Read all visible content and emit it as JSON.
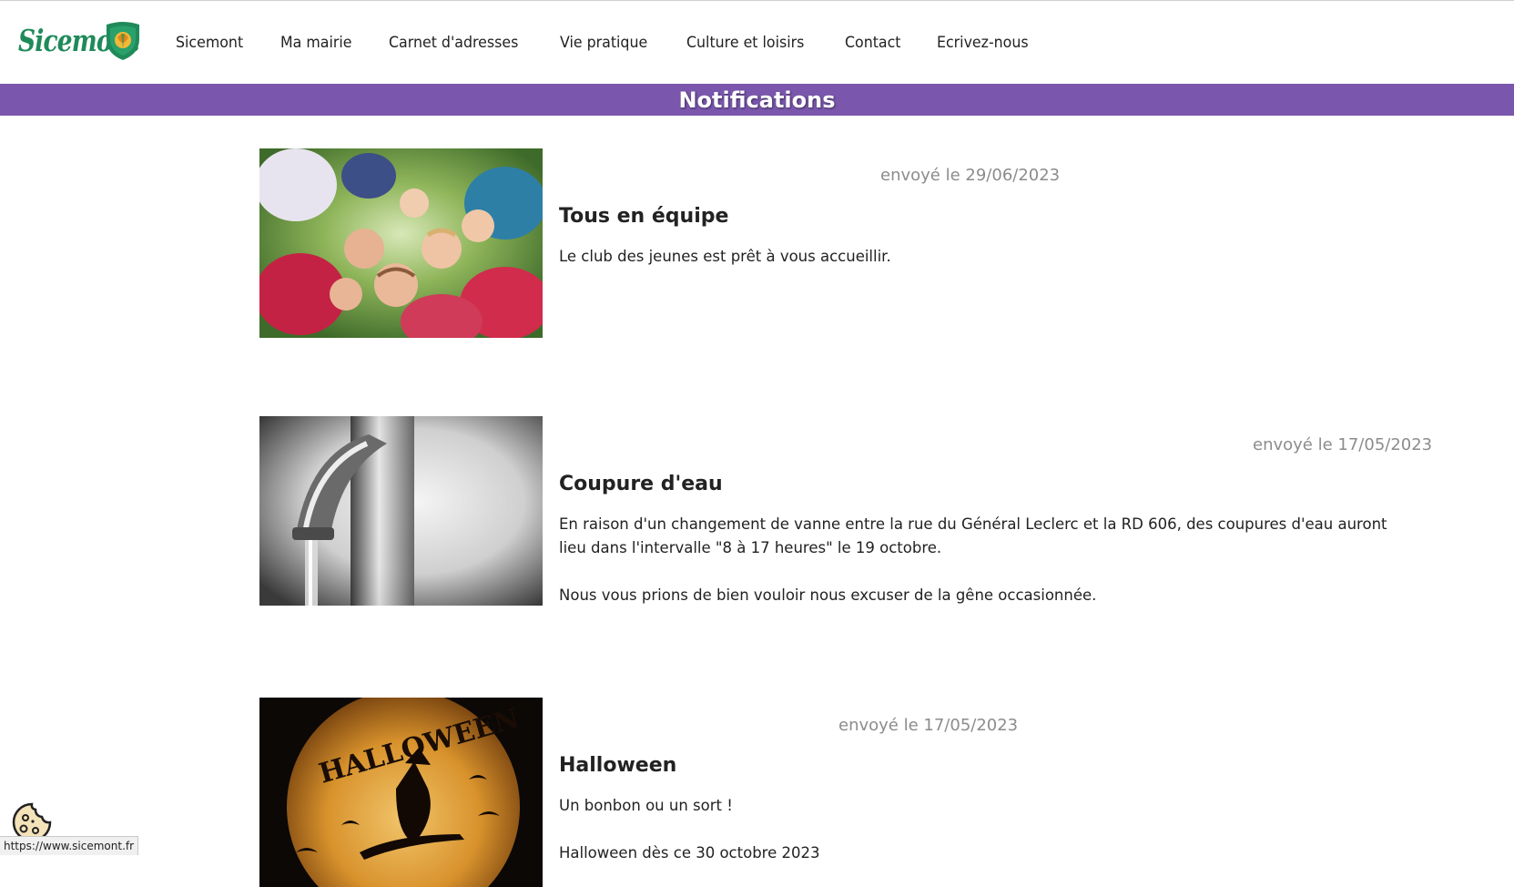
{
  "logo": {
    "text": "Sicemont"
  },
  "nav": [
    {
      "label": "Sicemont"
    },
    {
      "label": "Ma mairie"
    },
    {
      "label": "Carnet d'adresses"
    },
    {
      "label": "Vie pratique"
    },
    {
      "label": "Culture et loisirs"
    },
    {
      "label": "Contact"
    },
    {
      "label": "Ecrivez-nous"
    }
  ],
  "banner": {
    "title": "Notifications"
  },
  "notifications": [
    {
      "date": "envoyé le 29/06/2023",
      "title": "Tous en équipe",
      "paragraphs": [
        "Le club des jeunes est prêt à vous accueillir."
      ],
      "image": "kids-circle-photo"
    },
    {
      "date": "envoyé le 17/05/2023",
      "title": "Coupure d'eau",
      "paragraphs": [
        "En raison d'un changement de vanne entre la rue du Général Leclerc et la RD 606, des coupures d'eau auront lieu dans l'intervalle \"8 à 17 heures\" le 19 octobre.",
        "Nous vous prions de bien vouloir nous excuser de la gêne occasionnée."
      ],
      "image": "water-tap-photo"
    },
    {
      "date": "envoyé le 17/05/2023",
      "title": "Halloween",
      "paragraphs": [
        "Un bonbon ou un sort !",
        "Halloween dès ce 30 octobre 2023"
      ],
      "image": "halloween-witch-image",
      "image_text": "HALLOWEEN"
    }
  ],
  "status_bar": {
    "url": "https://www.sicemont.fr"
  },
  "colors": {
    "banner": "#7a57ad",
    "logo": "#1f8a5a",
    "date": "#8c8c8c"
  }
}
